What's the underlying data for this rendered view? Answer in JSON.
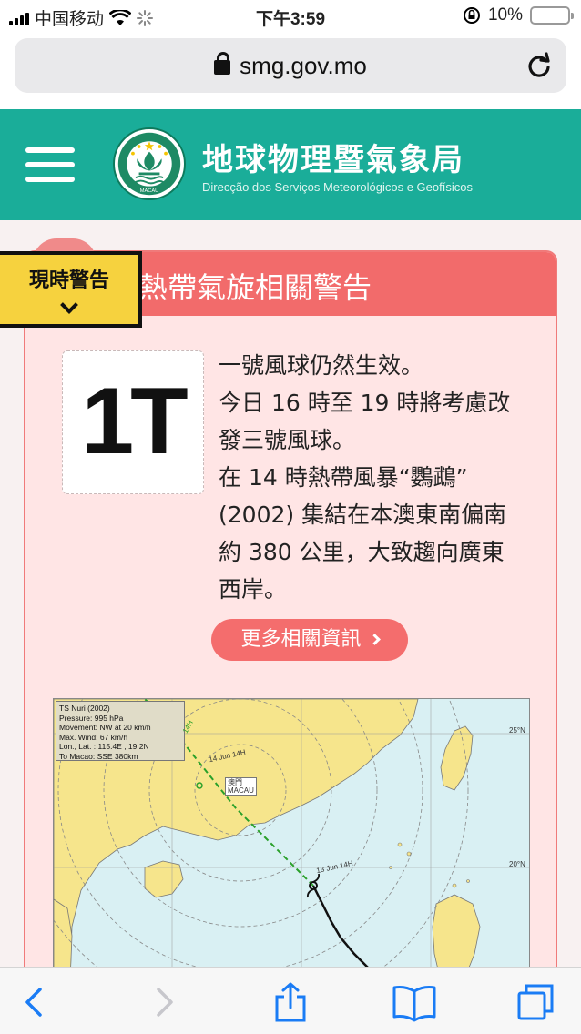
{
  "status_bar": {
    "carrier": "中国移动",
    "time": "下午3:59",
    "battery": "10%"
  },
  "browser": {
    "url": "smg.gov.mo"
  },
  "site": {
    "title_zh": "地球物理暨氣象局",
    "title_pt": "Direcção dos Serviços Meteorológicos e Geofísicos",
    "emblem_text": "MACAU"
  },
  "current_warning_tab": {
    "label": "現時警告"
  },
  "card": {
    "title": "熱帶氣旋相關警告",
    "signal_code": "1T",
    "message_lines": [
      "一號風球仍然生效。",
      "今日 16 時至 19 時將考慮改",
      "發三號風球。",
      "在 14 時熱帶風暴“鸚鵡”",
      "(2002) 集結在本澳東南偏南",
      "約 380 公里，大致趨向廣東",
      "西岸。"
    ],
    "more_button": "更多相關資訊"
  },
  "map": {
    "info_lines": [
      "TS Nuri (2002)",
      "Pressure: 995 hPa",
      "Movement: NW at 20 km/h",
      "Max. Wind: 67 km/h",
      "Lon., Lat. : 115.4E , 19.2N",
      "To Macao: SSE 380km"
    ],
    "lat_labels": [
      "25°N",
      "20°N"
    ],
    "macau_label_zh": "澳門",
    "macau_label": "MACAU",
    "track_labels": [
      "14 Jun 14H",
      "13 Jun 14H",
      "14H"
    ]
  }
}
